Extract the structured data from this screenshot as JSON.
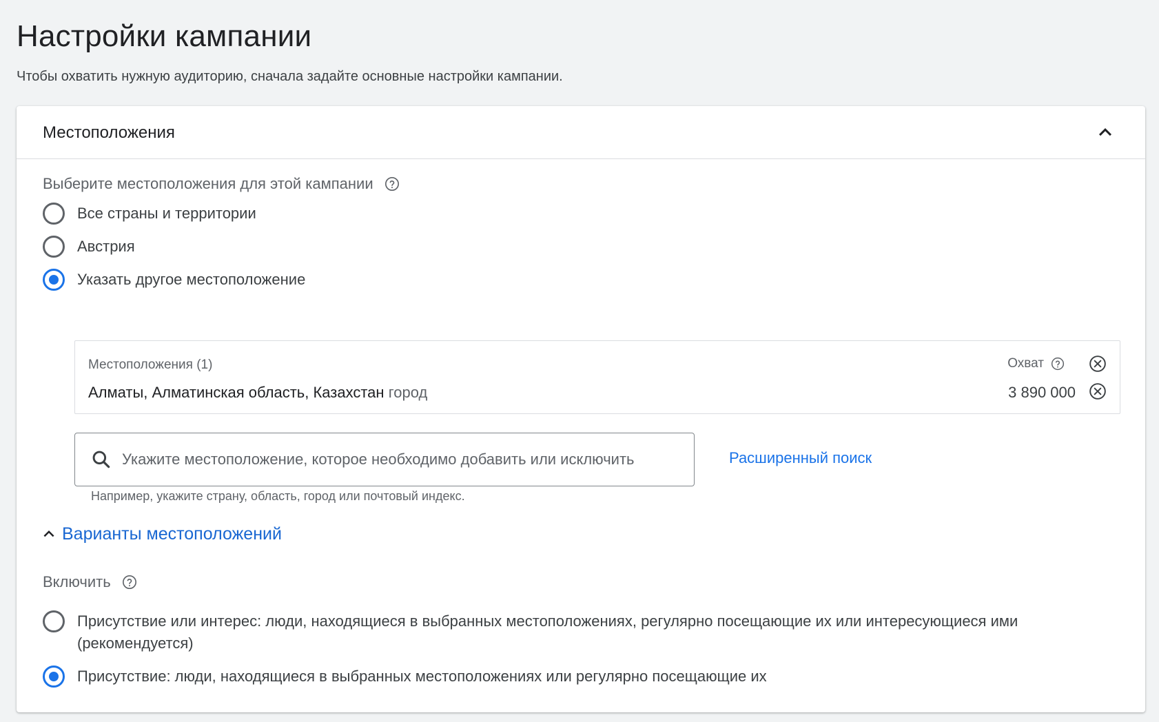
{
  "page": {
    "title": "Настройки кампании",
    "subtitle": "Чтобы охватить нужную аудиторию, сначала задайте основные настройки кампании."
  },
  "locations_card": {
    "title": "Местоположения",
    "select_label": "Выберите местоположения для этой кампании",
    "options": [
      {
        "label": "Все страны и территории",
        "selected": false
      },
      {
        "label": "Австрия",
        "selected": false
      },
      {
        "label": "Указать другое местоположение",
        "selected": true
      }
    ],
    "selected_box": {
      "title": "Местоположения (1)",
      "reach_label": "Охват",
      "items": [
        {
          "name": "Алматы, Алматинская область, Казахстан",
          "type": "город",
          "reach": "3 890 000"
        }
      ]
    },
    "search": {
      "placeholder": "Укажите местоположение, которое необходимо добавить или исключить",
      "value": "",
      "hint": "Например, укажите страну, область, город или почтовый индекс.",
      "advanced_link": "Расширенный поиск"
    },
    "variants": {
      "toggle_label": "Варианты местоположений",
      "include_label": "Включить",
      "options": [
        {
          "label": "Присутствие или интерес: люди, находящиеся в выбранных местоположениях, регулярно посещающие их или интересующиеся ими (рекомендуется)",
          "selected": false
        },
        {
          "label": "Присутствие: люди, находящиеся в выбранных местоположениях или регулярно посещающие их",
          "selected": true
        }
      ]
    }
  },
  "colors": {
    "accent": "#1a73e8",
    "link": "#1967d2",
    "background": "#f1f3f4"
  }
}
